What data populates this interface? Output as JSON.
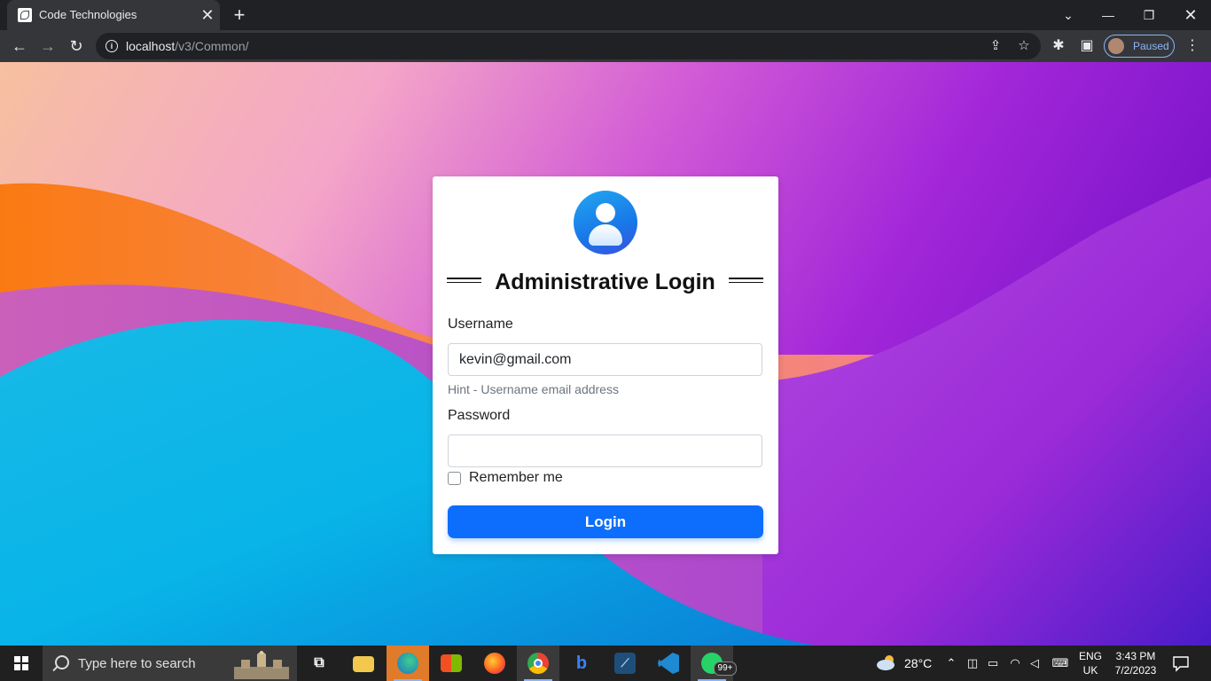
{
  "browser": {
    "tab_title": "Code Technologies",
    "url_host": "localhost",
    "url_path": "/v3/Common/",
    "profile_status": "Paused"
  },
  "login": {
    "title": "Administrative Login",
    "username_label": "Username",
    "username_value": "kevin@gmail.com",
    "username_hint": "Hint - Username email address",
    "password_label": "Password",
    "password_value": "",
    "remember_label": "Remember me",
    "remember_checked": false,
    "submit_label": "Login"
  },
  "taskbar": {
    "search_placeholder": "Type here to search",
    "apps": [
      "task-view",
      "file-explorer",
      "edge",
      "store",
      "firefox",
      "chrome",
      "bing",
      "mysql-workbench",
      "vscode",
      "whatsapp"
    ],
    "whatsapp_badge": "99+",
    "weather_temp": "28°C",
    "language": "ENG",
    "keyboard_layout": "UK",
    "time": "3:43 PM",
    "date": "7/2/2023"
  },
  "colors": {
    "primary_button": "#0d6efd",
    "browser_frame": "#202124",
    "taskbar": "#202020"
  }
}
